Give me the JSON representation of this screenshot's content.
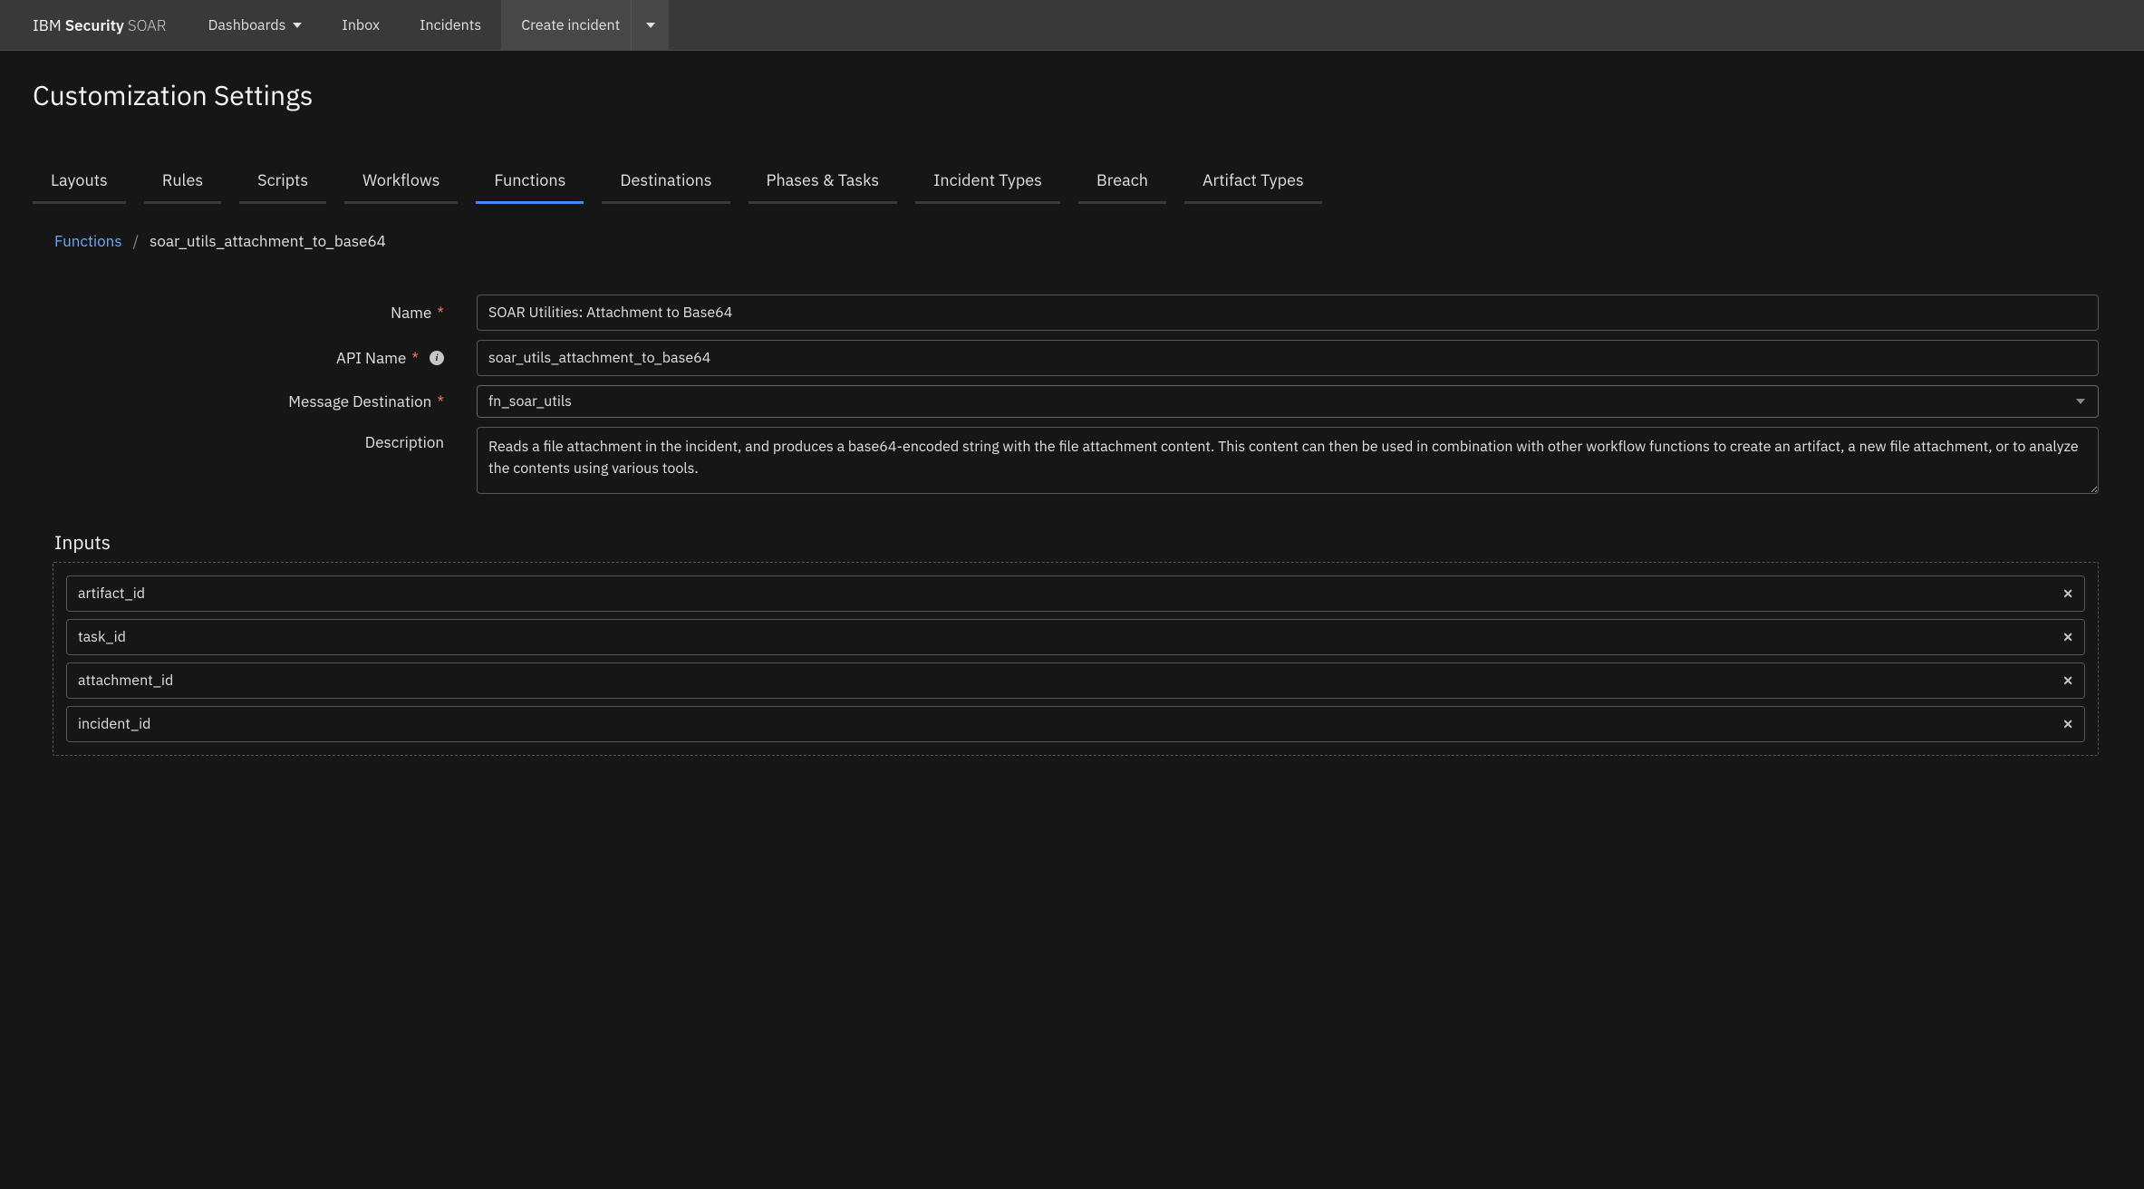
{
  "brand": {
    "line1_a": "IBM",
    "line1_b": "Security",
    "line1_c": "SOAR"
  },
  "nav": {
    "dashboards": "Dashboards",
    "inbox": "Inbox",
    "incidents": "Incidents",
    "create": "Create incident"
  },
  "page": {
    "title": "Customization Settings"
  },
  "tabs": [
    {
      "label": "Layouts"
    },
    {
      "label": "Rules"
    },
    {
      "label": "Scripts"
    },
    {
      "label": "Workflows"
    },
    {
      "label": "Functions",
      "active": true
    },
    {
      "label": "Destinations"
    },
    {
      "label": "Phases & Tasks"
    },
    {
      "label": "Incident Types"
    },
    {
      "label": "Breach"
    },
    {
      "label": "Artifact Types"
    }
  ],
  "breadcrumb": {
    "root": "Functions",
    "sep": "/",
    "current": "soar_utils_attachment_to_base64"
  },
  "form": {
    "nameLabel": "Name",
    "apiNameLabel": "API Name",
    "destLabel": "Message Destination",
    "descLabel": "Description",
    "name": "SOAR Utilities: Attachment to Base64",
    "apiName": "soar_utils_attachment_to_base64",
    "destination": "fn_soar_utils",
    "description": "Reads a file attachment in the incident, and produces a base64-encoded string with the file attachment content. This content can then be used in combination with other workflow functions to create an artifact, a new file attachment, or to analyze the contents using various tools."
  },
  "inputs": {
    "title": "Inputs",
    "items": [
      "artifact_id",
      "task_id",
      "attachment_id",
      "incident_id"
    ]
  }
}
